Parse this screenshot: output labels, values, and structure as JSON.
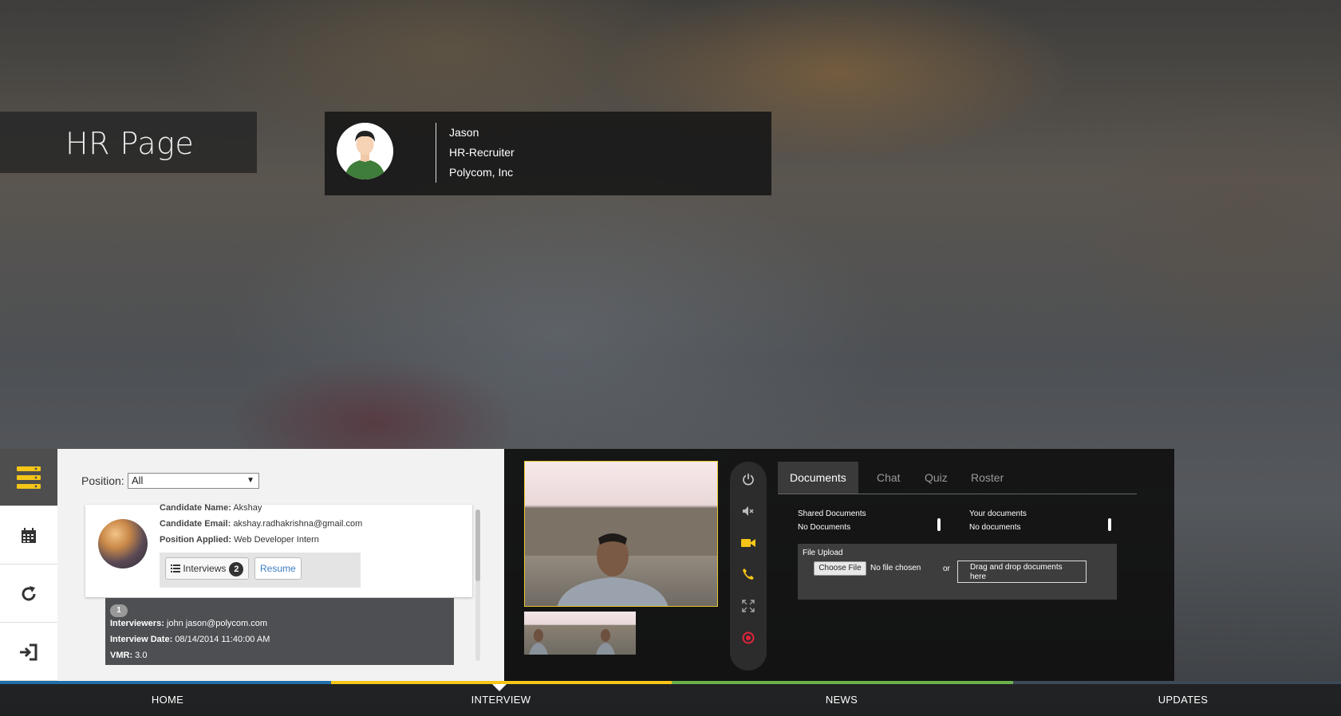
{
  "page": {
    "title": "HR Page"
  },
  "profile": {
    "name": "Jason",
    "role": "HR-Recruiter",
    "company": "Polycom, Inc"
  },
  "sidebar": {
    "items": [
      {
        "icon": "list-icon",
        "active": true
      },
      {
        "icon": "calendar-icon",
        "active": false
      },
      {
        "icon": "refresh-icon",
        "active": false
      },
      {
        "icon": "login-icon",
        "active": false
      }
    ]
  },
  "filter": {
    "label": "Position:",
    "selected": "All"
  },
  "candidate": {
    "name_label": "Candidate Name:",
    "name": "Akshay",
    "email_label": "Candidate Email:",
    "email": "akshay.radhakrishna@gmail.com",
    "position_label": "Position Applied:",
    "position": "Web Developer Intern",
    "interviews_label": "Interviews",
    "interviews_count": "2",
    "resume_label": "Resume"
  },
  "interview": {
    "number": "1",
    "interviewers_label": "Interviewers:",
    "interviewers": "john jason@polycom.com",
    "date_label": "Interview Date:",
    "date": "08/14/2014 11:40:00 AM",
    "vmr_label": "VMR:",
    "vmr": "3.0"
  },
  "controls": [
    "power-icon",
    "mute-icon",
    "camera-icon",
    "phone-icon",
    "fullscreen-icon",
    "record-icon"
  ],
  "tabs": [
    "Documents",
    "Chat",
    "Quiz",
    "Roster"
  ],
  "documents": {
    "shared_title": "Shared Documents",
    "shared_empty": "No Documents",
    "yours_title": "Your documents",
    "yours_empty": "No documents",
    "upload_title": "File Upload",
    "choose_label": "Choose File",
    "no_file": "No file chosen",
    "or": "or",
    "drop_text": "Drag and drop documents here"
  },
  "nav": {
    "items": [
      "HOME",
      "INTERVIEW",
      "NEWS",
      "UPDATES"
    ],
    "active": "INTERVIEW",
    "colors": [
      "#1f6fa8",
      "#f5c518",
      "#6bb04a",
      "#3c4a58"
    ]
  },
  "colors": {
    "accent": "#f5c518",
    "record": "#e0243c"
  }
}
